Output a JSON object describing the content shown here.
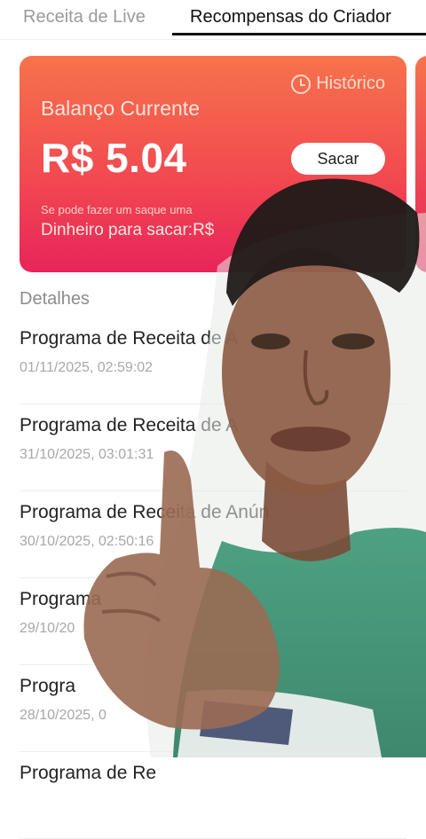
{
  "tabs": {
    "live": "Receita de Live",
    "rewards": "Recompensas do Criador"
  },
  "card": {
    "history": "Histórico",
    "balance_label": "Balanço Currente",
    "balance_value": "R$ 5.04",
    "withdraw": "Sacar",
    "note": "Se pode fazer um saque uma",
    "available": "Dinheiro para sacar:R$"
  },
  "details": {
    "title": "Detalhes",
    "rows": [
      {
        "title": "Programa de Receita de A",
        "date": "01/11/2025, 02:59:02"
      },
      {
        "title": "Programa de Receita de A",
        "date": "31/10/2025, 03:01:31"
      },
      {
        "title": "Programa de Receita de Anún",
        "date": "30/10/2025, 02:50:16"
      },
      {
        "title": "Programa",
        "date": "29/10/20"
      },
      {
        "title": "Progra",
        "date": "28/10/2025, 0"
      },
      {
        "title": "Programa de Re",
        "date": ""
      }
    ]
  },
  "colors": {
    "card_top": "#f6734c",
    "card_bottom": "#e8245a",
    "active_tab_underline": "#111111"
  }
}
